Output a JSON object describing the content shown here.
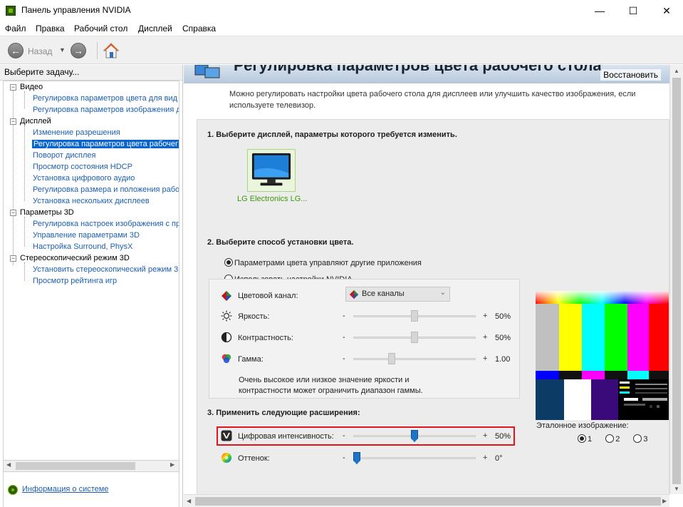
{
  "window": {
    "title": "Панель управления NVIDIA",
    "minimize": "—",
    "maximize": "☐",
    "close": "✕"
  },
  "menu": [
    "Файл",
    "Правка",
    "Рабочий стол",
    "Дисплей",
    "Справка"
  ],
  "toolbar": {
    "back_label": "Назад",
    "back_icon": "arrow-left-icon",
    "forward_icon": "arrow-right-icon",
    "home_icon": "home-icon"
  },
  "left": {
    "header": "Выберите задачу...",
    "tree": [
      {
        "label": "Видео",
        "items": [
          "Регулировка параметров цвета для вид",
          "Регулировка параметров изображения д"
        ]
      },
      {
        "label": "Дисплей",
        "items": [
          "Изменение разрешения",
          "Регулировка параметров цвета рабочег",
          "Поворот дисплея",
          "Просмотр состояния HDCP",
          "Установка цифрового аудио",
          "Регулировка размера и положения рабо",
          "Установка нескольких дисплеев"
        ]
      },
      {
        "label": "Параметры 3D",
        "items": [
          "Регулировка настроек изображения с пр",
          "Управление параметрами 3D",
          "Настройка Surround, PhysX"
        ]
      },
      {
        "label": "Стереоскопический режим 3D",
        "items": [
          "Установить стереоскопический режим 3",
          "Просмотр рейтинга игр"
        ]
      }
    ],
    "selected": "Регулировка параметров цвета рабочег",
    "sysinfo": "Информация о системе"
  },
  "page": {
    "title": "Регулировка параметров цвета рабочего стола",
    "restore": "Восстановить",
    "desc": "Можно регулировать настройки цвета рабочего стола для дисплеев или улучшить качество изображения, если используете телевизор.",
    "step1": "1. Выберите дисплей, параметры которого требуется изменить.",
    "display_name": "LG Electronics LG...",
    "step2": "2. Выберите способ установки цвета.",
    "radio_other": "Параметрами цвета управляют другие приложения",
    "radio_nvidia": "Использовать настройки NVIDIA",
    "color_channel_label": "Цветовой канал:",
    "color_channel_value": "Все каналы",
    "brightness_label": "Яркость:",
    "brightness_value": "50%",
    "brightness_level": 0.5,
    "contrast_label": "Контрастность:",
    "contrast_value": "50%",
    "contrast_level": 0.5,
    "gamma_label": "Гамма:",
    "gamma_value": "1.00",
    "gamma_level": 0.3,
    "note": "Очень высокое или низкое значение яркости и контрастности может ограничить диапазон гаммы.",
    "step3": "3. Применить следующие расширения:",
    "vibrance_label": "Цифровая интенсивность:",
    "vibrance_value": "50%",
    "vibrance_level": 0.5,
    "hue_label": "Оттенок:",
    "hue_value": "0°",
    "hue_level": 0.0,
    "minus": "-",
    "plus": "+",
    "ref_label": "Эталонное изображение:",
    "ref_options": [
      "1",
      "2",
      "3"
    ],
    "ref_selected": "1"
  },
  "colors": {
    "accent": "#76b900",
    "selection": "#0a64cf",
    "highlight_border": "#e0161c"
  }
}
